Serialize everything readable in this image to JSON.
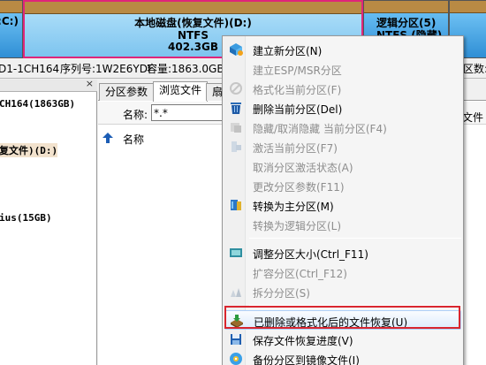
{
  "partitions": [
    {
      "label": ":C:)",
      "fs": "",
      "size": ""
    },
    {
      "label": "本地磁盘(恢复文件)(D:)",
      "fs": "NTFS",
      "size": "402.3GB"
    },
    {
      "label": "逻辑分区(5)",
      "fs": "NTFS (隐藏)",
      "size": ""
    }
  ],
  "disk_info": {
    "model": "D1-1CH164",
    "serial": "序列号:1W2E6YDF",
    "capacity": "容量:1863.0GB(",
    "sectors": "区数:"
  },
  "left_panel": {
    "close": "×",
    "items": [
      {
        "text": "CH164(1863GB)"
      },
      {
        "text": "复文件)(D:)"
      },
      {
        "text": "ius(15GB)"
      }
    ]
  },
  "tabs": [
    {
      "label": "分区参数"
    },
    {
      "label": "浏览文件"
    },
    {
      "label": "扇"
    }
  ],
  "browser": {
    "name_label": "名称:",
    "name_value": "*.*",
    "col_name": "名称",
    "col_file": "文件"
  },
  "context_menu": {
    "items": [
      {
        "label": "建立新分区(N)",
        "icon": "new-partition-icon",
        "enabled": true
      },
      {
        "label": "建立ESP/MSR分区",
        "icon": "",
        "enabled": false
      },
      {
        "label": "格式化当前分区(F)",
        "icon": "format-icon",
        "enabled": false
      },
      {
        "label": "删除当前分区(Del)",
        "icon": "trash-icon",
        "enabled": true
      },
      {
        "label": "隐藏/取消隐藏 当前分区(F4)",
        "icon": "hide-icon",
        "enabled": false
      },
      {
        "label": "激活当前分区(F7)",
        "icon": "activate-icon",
        "enabled": false
      },
      {
        "label": "取消分区激活状态(A)",
        "icon": "",
        "enabled": false
      },
      {
        "label": "更改分区参数(F11)",
        "icon": "",
        "enabled": false
      },
      {
        "label": "转换为主分区(M)",
        "icon": "convert-primary-icon",
        "enabled": true
      },
      {
        "label": "转换为逻辑分区(L)",
        "icon": "",
        "enabled": false
      },
      {
        "label": "调整分区大小(Ctrl_F11)",
        "icon": "resize-icon",
        "enabled": true
      },
      {
        "label": "扩容分区(Ctrl_F12)",
        "icon": "",
        "enabled": false
      },
      {
        "label": "拆分分区(S)",
        "icon": "split-icon",
        "enabled": false
      },
      {
        "label": "已删除或格式化后的文件恢复(U)",
        "icon": "recover-icon",
        "enabled": true,
        "highlighted": true
      },
      {
        "label": "保存文件恢复进度(V)",
        "icon": "save-icon",
        "enabled": true
      },
      {
        "label": "备份分区到镜像文件(I)",
        "icon": "backup-icon",
        "enabled": true
      }
    ]
  }
}
